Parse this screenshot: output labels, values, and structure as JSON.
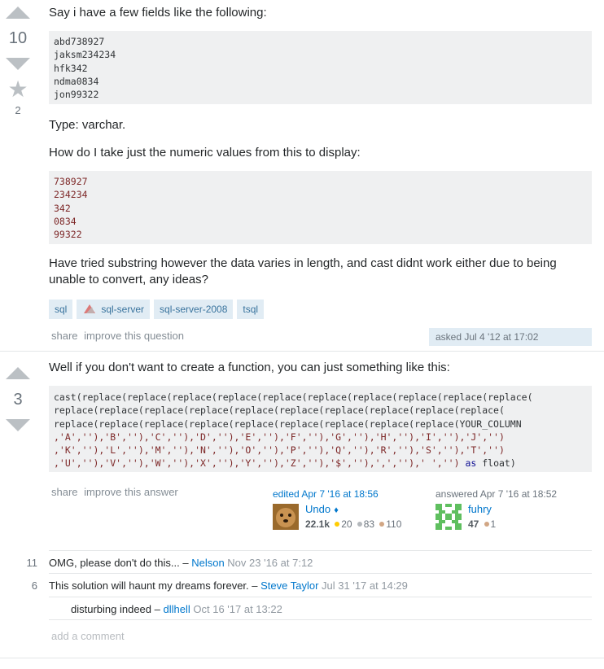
{
  "question": {
    "votes": "10",
    "favorites": "2",
    "intro": "Say i have a few fields like the following:",
    "code_fields": "abd738927\njaksm234234\nhfk342\nndma0834\njon99322",
    "type_line": "Type: varchar.",
    "how_line": "How do I take just the numeric values from this to display:",
    "code_numbers": "738927\n234234\n342\n0834\n99322",
    "tried_line": "Have tried substring however the data varies in length, and cast didnt work either due to being unable to convert, any ideas?",
    "tags": [
      "sql",
      "sql-server",
      "sql-server-2008",
      "tsql"
    ],
    "menu": {
      "share": "share",
      "improve": "improve this question"
    },
    "asked": "asked Jul 4 '12 at 17:02"
  },
  "answer": {
    "votes": "3",
    "intro": "Well if you don't want to create a function, you can just something like this:",
    "code_lines": [
      "cast(replace(replace(replace(replace(replace(replace(replace(replace(replace(replace(",
      "replace(replace(replace(replace(replace(replace(replace(replace(replace(replace(",
      "replace(replace(replace(replace(replace(replace(replace(replace(replace(YOUR_COLUMN",
      ",'A',''),'B',''),'C',''),'D',''),'E',''),'F',''),'G',''),'H',''),'I',''),'J','')",
      ",'K',''),'L',''),'M',''),'N',''),'O',''),'P',''),'Q',''),'R',''),'S',''),'T','')",
      ",'U',''),'V',''),'W',''),'X',''),'Y',''),'Z',''),'$',''),',',''),' ','')"
    ],
    "code_tail_kw": "as",
    "code_tail_type": "float)",
    "menu": {
      "share": "share",
      "improve": "improve this answer"
    },
    "edited": {
      "action": "edited Apr 7 '16 at 18:56",
      "user": "Undo",
      "diamond": "♦",
      "rep": "22.1k",
      "gold": "20",
      "silver": "83",
      "bronze": "110"
    },
    "answered": {
      "action": "answered Apr 7 '16 at 18:52",
      "user": "fuhry",
      "rep": "47",
      "bronze": "1"
    }
  },
  "comments": [
    {
      "score": "11",
      "text": "OMG, please don't do this...",
      "dash": " – ",
      "user": "Nelson",
      "date": "Nov 23 '16 at 7:12"
    },
    {
      "score": "6",
      "text": "This solution will haunt my dreams forever.",
      "dash": " – ",
      "user": "Steve Taylor",
      "date": "Jul 31 '17 at 14:29"
    },
    {
      "score": "",
      "text": "disturbing indeed",
      "dash": " – ",
      "user": "dllhell",
      "date": "Oct 16 '17 at 13:22"
    }
  ],
  "add_comment": "add a comment",
  "colors": {
    "link": "#0077cc",
    "tag_bg": "#e1ecf4",
    "tag_fg": "#39739d",
    "code_bg": "#eff0f1"
  }
}
